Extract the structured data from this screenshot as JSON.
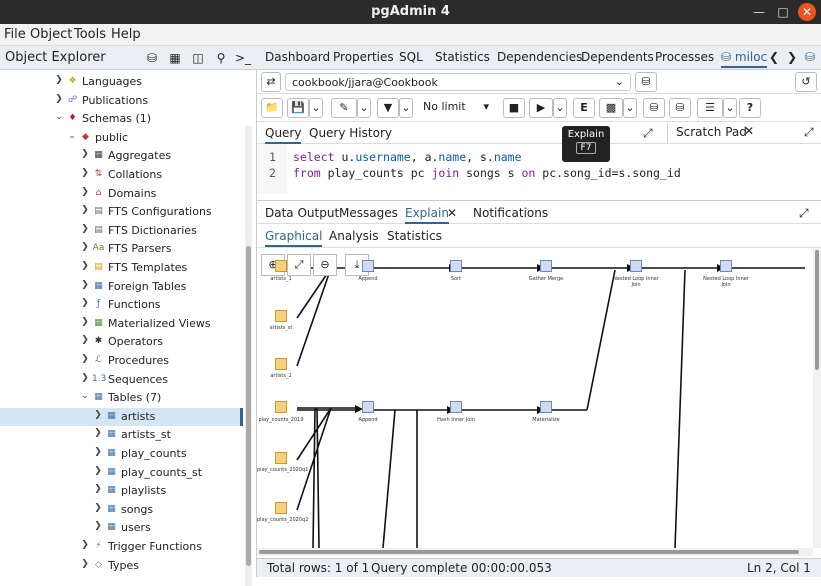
{
  "window": {
    "title": "pgAdmin 4"
  },
  "menu": [
    "File",
    "Object",
    "Tools",
    "Help"
  ],
  "object_explorer": {
    "title": "Object Explorer",
    "items": [
      {
        "label": "Languages",
        "icon": "languages-icon",
        "level": 4
      },
      {
        "label": "Publications",
        "icon": "publications-icon",
        "level": 4
      },
      {
        "label": "Schemas (1)",
        "icon": "schemas-icon",
        "level": 4,
        "open": true
      },
      {
        "label": "public",
        "icon": "schema-icon",
        "level": 5,
        "open": true
      },
      {
        "label": "Aggregates",
        "icon": "aggregates-icon",
        "level": 6
      },
      {
        "label": "Collations",
        "icon": "collations-icon",
        "level": 6
      },
      {
        "label": "Domains",
        "icon": "domains-icon",
        "level": 6
      },
      {
        "label": "FTS Configurations",
        "icon": "fts-config-icon",
        "level": 6
      },
      {
        "label": "FTS Dictionaries",
        "icon": "fts-dict-icon",
        "level": 6
      },
      {
        "label": "FTS Parsers",
        "icon": "fts-parser-icon",
        "level": 6
      },
      {
        "label": "FTS Templates",
        "icon": "fts-template-icon",
        "level": 6
      },
      {
        "label": "Foreign Tables",
        "icon": "foreign-table-icon",
        "level": 6
      },
      {
        "label": "Functions",
        "icon": "functions-icon",
        "level": 6
      },
      {
        "label": "Materialized Views",
        "icon": "matview-icon",
        "level": 6
      },
      {
        "label": "Operators",
        "icon": "operators-icon",
        "level": 6
      },
      {
        "label": "Procedures",
        "icon": "procedures-icon",
        "level": 6
      },
      {
        "label": "Sequences",
        "icon": "sequences-icon",
        "level": 6
      },
      {
        "label": "Tables (7)",
        "icon": "tables-icon",
        "level": 6,
        "open": true
      },
      {
        "label": "artists",
        "icon": "table-icon",
        "level": 7,
        "selected": true
      },
      {
        "label": "artists_st",
        "icon": "table-icon",
        "level": 7
      },
      {
        "label": "play_counts",
        "icon": "table-icon",
        "level": 7
      },
      {
        "label": "play_counts_st",
        "icon": "table-icon",
        "level": 7
      },
      {
        "label": "playlists",
        "icon": "table-icon",
        "level": 7
      },
      {
        "label": "songs",
        "icon": "table-icon",
        "level": 7
      },
      {
        "label": "users",
        "icon": "table-icon",
        "level": 7
      },
      {
        "label": "Trigger Functions",
        "icon": "trigger-functions-icon",
        "level": 6
      },
      {
        "label": "Types",
        "icon": "types-icon",
        "level": 6
      }
    ]
  },
  "main_tabs": [
    "Dashboard",
    "Properties",
    "SQL",
    "Statistics",
    "Dependencies",
    "Dependents",
    "Processes",
    "miloc"
  ],
  "connection": {
    "value": "cookbook/jjara@Cookbook"
  },
  "toolbar": {
    "limit": "No limit",
    "explain_label": "E"
  },
  "tooltip": {
    "title": "Explain",
    "key": "F7"
  },
  "query_tabs": [
    "Query",
    "Query History"
  ],
  "scratch_pad": "Scratch Pad",
  "editor": {
    "lines": [
      {
        "num": "1"
      },
      {
        "num": "2"
      }
    ],
    "line1": {
      "kw": "select",
      "rest": " u.",
      "a": "username",
      "b": ", a.",
      "c": "name",
      "d": ", s.",
      "e": "name"
    },
    "line2": {
      "kw": "from",
      "rest": " play_counts pc ",
      "join": "join",
      "mid": " songs s ",
      "on": "on",
      "end": " pc.song_id=s.song_id"
    }
  },
  "output_tabs": [
    "Data Output",
    "Messages",
    "Explain",
    "Notifications"
  ],
  "explain_tabs": [
    "Graphical",
    "Analysis",
    "Statistics"
  ],
  "plan_nodes": [
    {
      "label": "artists_1"
    },
    {
      "label": "Append"
    },
    {
      "label": "Sort"
    },
    {
      "label": "Gather Merge"
    },
    {
      "label": "Nested Loop Inner Join"
    },
    {
      "label": "Nested Loop Inner Join"
    },
    {
      "label": "artists_st"
    },
    {
      "label": "artists_2"
    },
    {
      "label": "play_counts_2019"
    },
    {
      "label": "Append"
    },
    {
      "label": "Hash Inner Join"
    },
    {
      "label": "Materialize"
    },
    {
      "label": "play_counts_2020q1"
    },
    {
      "label": "play_counts_2020q2"
    }
  ],
  "status": {
    "rows": "Total rows: 1 of 1",
    "query": "Query complete 00:00:00.053",
    "pos": "Ln 2, Col 1"
  }
}
